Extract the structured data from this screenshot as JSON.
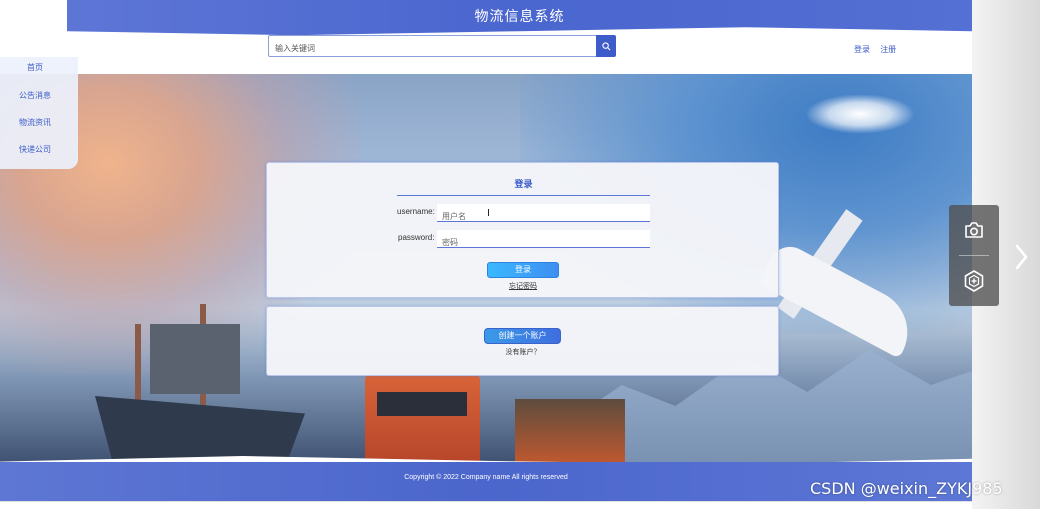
{
  "header": {
    "site_title": "物流信息系统",
    "search_placeholder": "输入关键词",
    "login_link": "登录",
    "register_link": "注册"
  },
  "sidebar": {
    "items": [
      {
        "label": "首页"
      },
      {
        "label": "公告消息"
      },
      {
        "label": "物流资讯"
      },
      {
        "label": "快递公司"
      }
    ]
  },
  "login_form": {
    "title": "登录",
    "username_label": "username:",
    "username_placeholder": "用户名",
    "password_label": "password:",
    "password_placeholder": "密码",
    "login_button": "登录",
    "forgot_password": "忘记密码"
  },
  "register_panel": {
    "create_button": "创建一个账户",
    "no_account_text": "没有账户？"
  },
  "footer": {
    "copyright": "Copyright © 2022 Company name All rights reserved"
  },
  "tools": {
    "screenshot_icon": "camera-icon",
    "badge_icon": "hexagon-plus-icon",
    "next_icon": "chevron-right-icon"
  },
  "watermark": "CSDN @weixin_ZYKJ985",
  "colors": {
    "brand_blue": "#4a66cf",
    "link_blue": "#3b5bc9",
    "button_cyan": "#3ab8ff"
  }
}
